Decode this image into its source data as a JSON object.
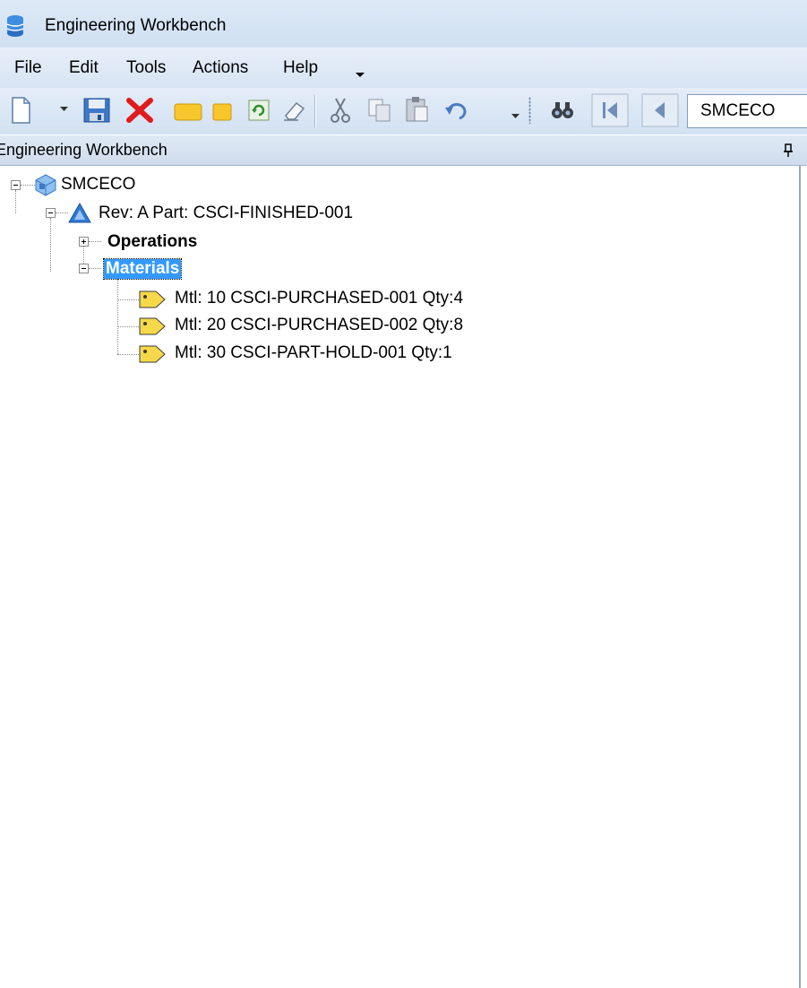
{
  "window": {
    "title": "Engineering Workbench"
  },
  "menu": {
    "items": [
      "File",
      "Edit",
      "Tools",
      "Actions",
      "Help"
    ]
  },
  "toolbar": {
    "icons": [
      "new-icon",
      "dropdown-arrow-icon",
      "save-icon",
      "delete-icon",
      "note-icon",
      "sticky-icon",
      "refresh-icon",
      "clear-icon",
      "cut-icon",
      "copy-icon",
      "paste-icon",
      "undo-icon",
      "search-icon",
      "first-icon",
      "previous-icon"
    ],
    "combo_value": "SMCECO"
  },
  "panel": {
    "title": "Engineering Workbench"
  },
  "tree": {
    "root": "SMCECO",
    "revision": "Rev: A Part: CSCI-FINISHED-001",
    "operations": "Operations",
    "materials": "Materials",
    "material_items": [
      "Mtl: 10  CSCI-PURCHASED-001  Qty:4",
      "Mtl: 20  CSCI-PURCHASED-002  Qty:8",
      "Mtl: 30  CSCI-PART-HOLD-001  Qty:1"
    ]
  },
  "colors": {
    "selection": "#3399ff",
    "chrome": "#d7e4f3",
    "tag": "#f7d84a"
  }
}
